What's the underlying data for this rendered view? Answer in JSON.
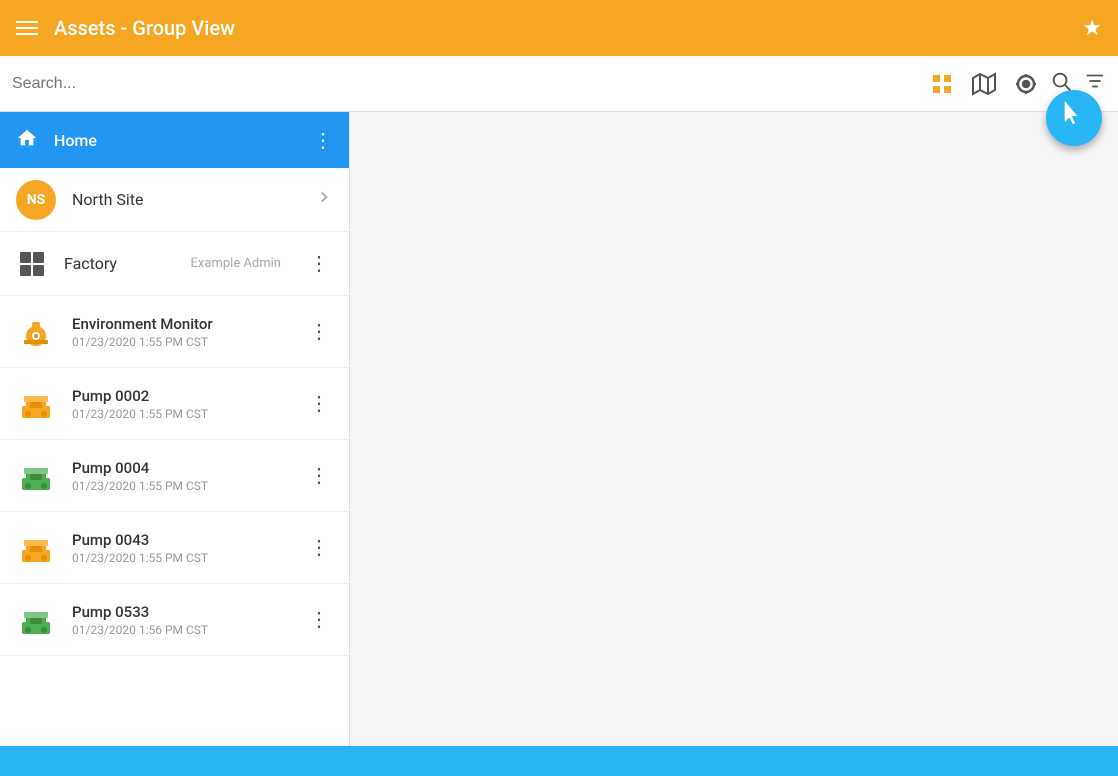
{
  "header": {
    "title": "Assets - Group View",
    "star_label": "★",
    "hamburger_label": "menu"
  },
  "search": {
    "placeholder": "Search...",
    "search_icon": "🔍",
    "filter_icon": "filter"
  },
  "toolbar": {
    "grid_icon": "grid",
    "map_icon": "map",
    "scan_icon": "scan",
    "fab_icon": "+"
  },
  "nav": {
    "home_label": "Home",
    "home_more": "⋮"
  },
  "north_site": {
    "initials": "NS",
    "label": "North Site"
  },
  "factory": {
    "label": "Factory",
    "admin": "Example Admin",
    "more": "⋮"
  },
  "assets": [
    {
      "name": "Environment Monitor",
      "date": "01/23/2020 1:55 PM CST",
      "icon_type": "env",
      "more": "⋮"
    },
    {
      "name": "Pump 0002",
      "date": "01/23/2020 1:55 PM CST",
      "icon_type": "pump_yellow",
      "more": "⋮"
    },
    {
      "name": "Pump 0004",
      "date": "01/23/2020 1:55 PM CST",
      "icon_type": "pump_green",
      "more": "⋮"
    },
    {
      "name": "Pump 0043",
      "date": "01/23/2020 1:55 PM CST",
      "icon_type": "pump_yellow",
      "more": "⋮"
    },
    {
      "name": "Pump 0533",
      "date": "01/23/2020 1:56 PM CST",
      "icon_type": "pump_green",
      "more": "⋮"
    }
  ]
}
